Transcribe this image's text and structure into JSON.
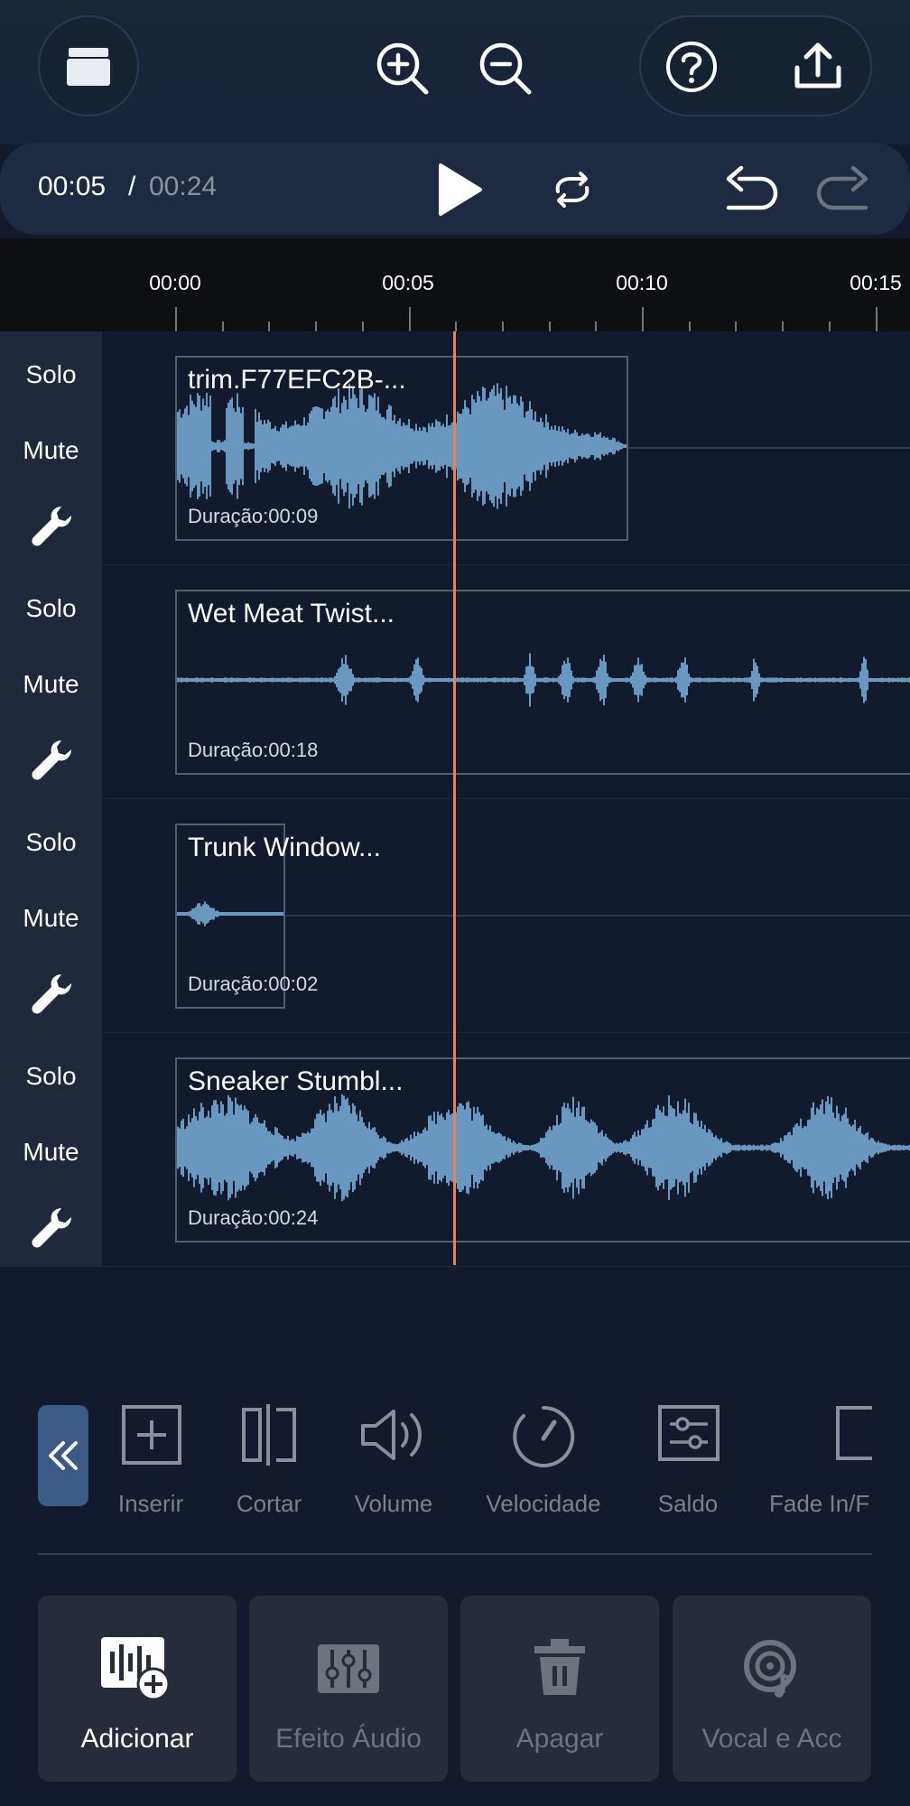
{
  "toolbar": {
    "library_icon": "folder-box-icon",
    "zoom_in_icon": "zoom-in-icon",
    "zoom_out_icon": "zoom-out-icon",
    "help_icon": "help-icon",
    "export_icon": "export-icon"
  },
  "transport": {
    "current_time": "00:05",
    "separator": "/",
    "total_time": "00:24"
  },
  "ruler": {
    "labels": [
      "00:00",
      "00:05",
      "00:10",
      "00:15"
    ]
  },
  "tracks": [
    {
      "solo": "Solo",
      "mute": "Mute",
      "clip_title": "trim.F77EFC2B-...",
      "clip_duration": "Duração:00:09"
    },
    {
      "solo": "Solo",
      "mute": "Mute",
      "clip_title": "Wet Meat Twist...",
      "clip_duration": "Duração:00:18"
    },
    {
      "solo": "Solo",
      "mute": "Mute",
      "clip_title": "Trunk Window...",
      "clip_duration": "Duração:00:02"
    },
    {
      "solo": "Solo",
      "mute": "Mute",
      "clip_title": "Sneaker Stumbl...",
      "clip_duration": "Duração:00:24"
    }
  ],
  "edit_tools": [
    {
      "label": "Inserir",
      "icon": "insert-icon"
    },
    {
      "label": "Cortar",
      "icon": "cut-icon"
    },
    {
      "label": "Volume",
      "icon": "volume-icon"
    },
    {
      "label": "Velocidade",
      "icon": "speed-icon"
    },
    {
      "label": "Saldo",
      "icon": "balance-icon"
    },
    {
      "label": "Fade In/F",
      "icon": "fade-icon"
    }
  ],
  "actions": [
    {
      "label": "Adicionar",
      "icon": "add-track-icon"
    },
    {
      "label": "Efeito Áudio",
      "icon": "audio-effect-icon"
    },
    {
      "label": "Apagar",
      "icon": "trash-icon"
    },
    {
      "label": "Vocal e Acc",
      "icon": "vocal-icon"
    }
  ],
  "colors": {
    "accent_playhead": "#e8815c",
    "waveform": "#6897bf",
    "background": "#141a2d"
  }
}
